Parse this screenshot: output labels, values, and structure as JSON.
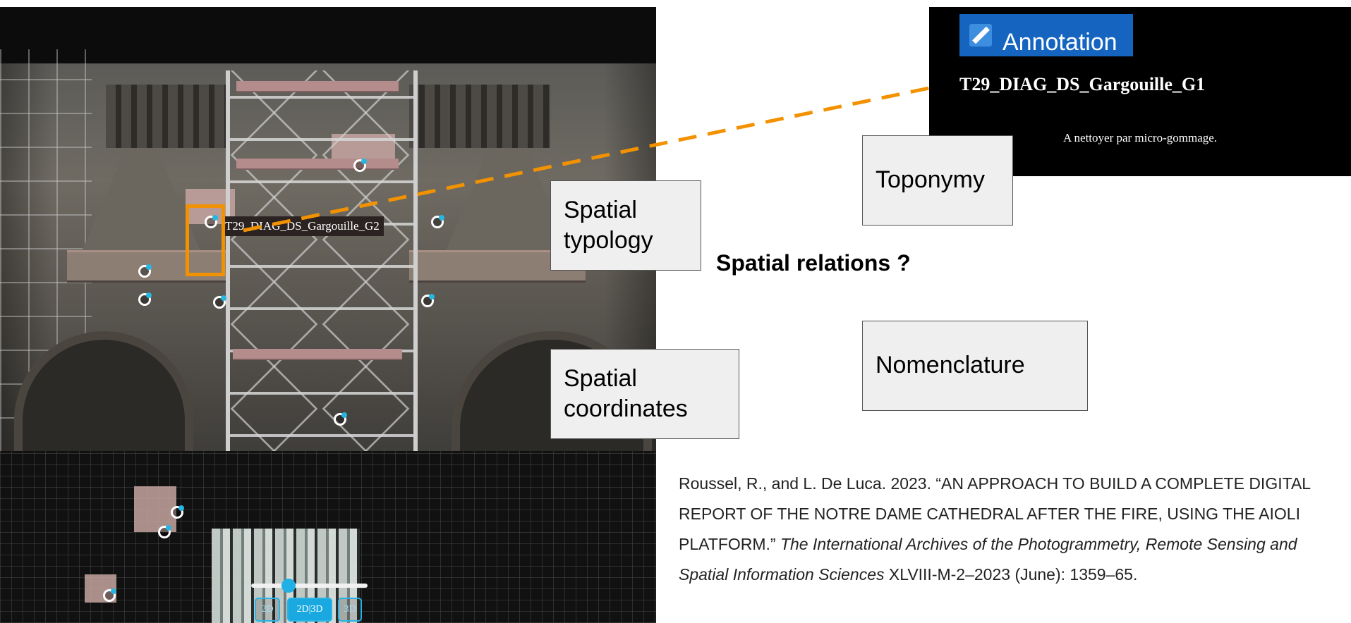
{
  "viewer": {
    "annotation_label": "T29_DIAG_DS_Gargouille_G2",
    "modes": [
      "2D",
      "2D|3D",
      "3D"
    ],
    "active_mode": "2D|3D",
    "slider_value": 0.3
  },
  "popup": {
    "header": "Annotation",
    "name": "T29_DIAG_DS_Gargouille_G1",
    "description": "A nettoyer par micro-gommage."
  },
  "concepts": {
    "spatial_typology": "Spatial\ntypology",
    "spatial_coordinates": "Spatial\ncoordinates",
    "toponymy": "Toponymy",
    "nomenclature": "Nomenclature",
    "spatial_relations": "Spatial relations ?"
  },
  "citation": {
    "part1": "Roussel, R., and L. De Luca. 2023. “AN APPROACH TO BUILD A COMPLETE DIGITAL REPORT OF THE NOTRE DAME CATHEDRAL AFTER THE FIRE, USING THE AIOLI PLATFORM.” ",
    "journal": "The International Archives of the Photogrammetry, Remote Sensing and Spatial Information Sciences",
    "part2": " XLVIII-M-2–2023 (June): 1359–65."
  },
  "colors": {
    "highlight": "#f39200",
    "popup_header": "#1565c0",
    "mode_accent": "#19a9e0"
  }
}
